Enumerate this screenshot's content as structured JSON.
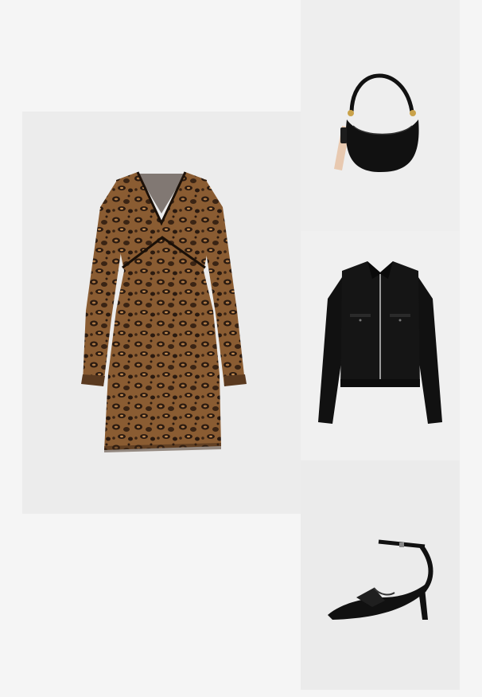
{
  "outfit": {
    "items": [
      {
        "id": "dress",
        "icon": "leopard-print-dress-icon"
      },
      {
        "id": "bag",
        "icon": "black-shoulder-bag-icon"
      },
      {
        "id": "jacket",
        "icon": "black-zip-jacket-icon"
      },
      {
        "id": "heels",
        "icon": "black-ankle-strap-heel-icon"
      }
    ],
    "colors": {
      "page_background": "#f5f5f5",
      "tile_background": "#ececec",
      "leopard_base": "#7a5230",
      "leopard_spot": "#2a1a10",
      "black_item": "#111111",
      "strap_beige": "#e8c9b0"
    }
  }
}
